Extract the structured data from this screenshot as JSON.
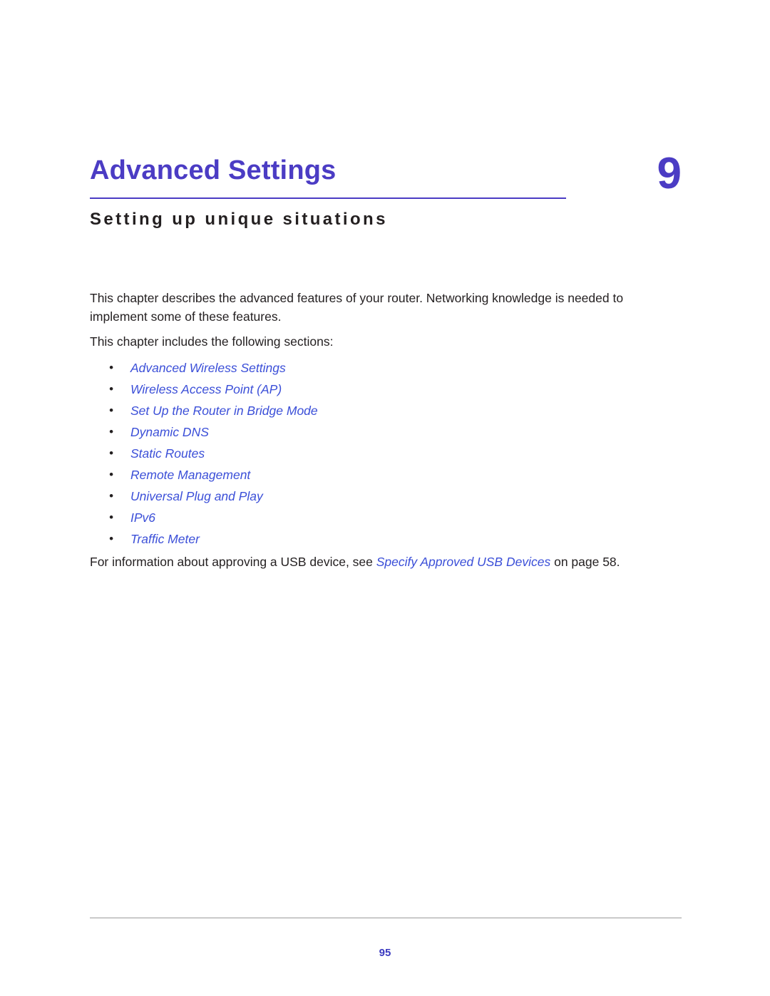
{
  "chapter": {
    "title": "Advanced Settings",
    "number": "9",
    "subtitle": "Setting up unique situations"
  },
  "body": {
    "intro_paragraph": "This chapter describes the advanced features of your router. Networking knowledge is needed to implement some of these features.",
    "sections_lead": "This chapter includes the following sections:",
    "bullet": "•",
    "section_links": [
      "Advanced Wireless Settings",
      "Wireless Access Point (AP)",
      "Set Up the Router in Bridge Mode",
      "Dynamic DNS",
      "Static Routes",
      "Remote Management",
      "Universal Plug and Play",
      "IPv6",
      "Traffic Meter"
    ],
    "closing_prefix": "For information about approving a USB device, see ",
    "closing_link": "Specify Approved USB Devices",
    "closing_suffix": " on page 58."
  },
  "footer": {
    "page_number": "95"
  },
  "colors": {
    "heading_purple": "#4b3cc4",
    "link_blue": "#3b4fd8",
    "body_text": "#231f20",
    "rule_gray": "#9b9b9b"
  }
}
